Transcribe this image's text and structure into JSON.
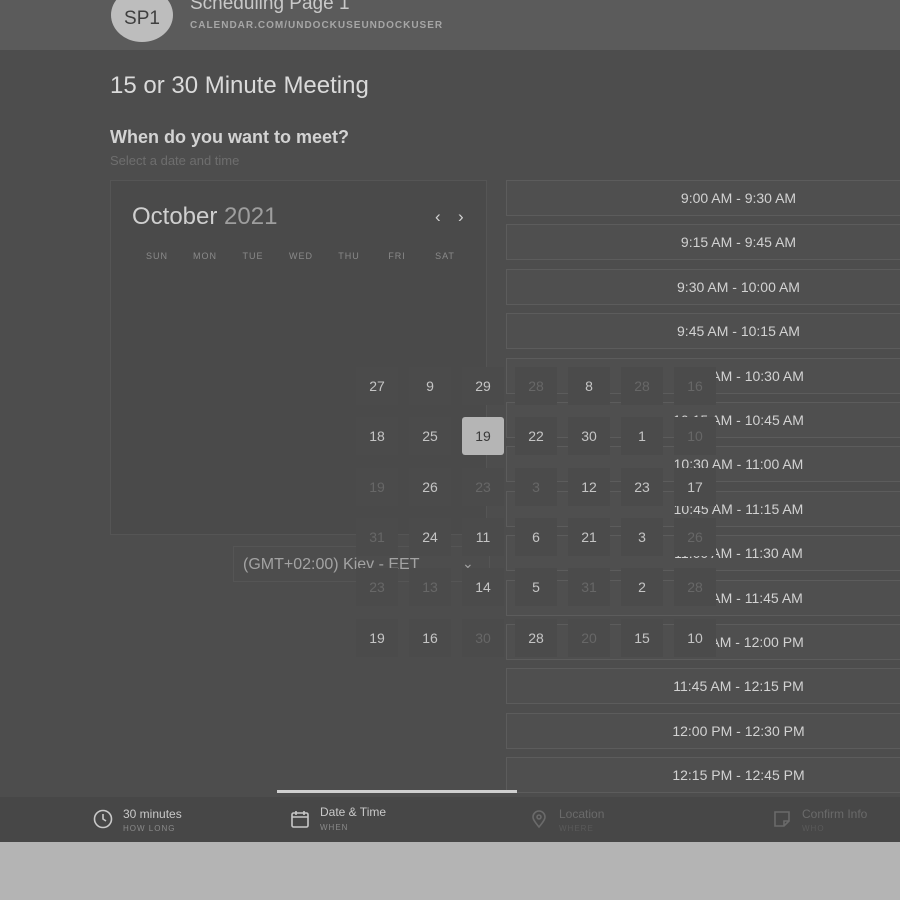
{
  "header": {
    "avatar_text": "SP1",
    "page_name": "Scheduling Page 1",
    "url": "CALENDAR.COM/UNDOCKUSEUNDOCKUSER"
  },
  "main": {
    "title": "15 or 30 Minute Meeting",
    "question": "When do you want to meet?",
    "subtitle": "Select a date and time"
  },
  "calendar": {
    "month": "October",
    "year": "2021",
    "prev_icon": "chevron-left-icon",
    "next_icon": "chevron-right-icon",
    "weekdays": [
      "SUN",
      "MON",
      "TUE",
      "WED",
      "THU",
      "FRI",
      "SAT"
    ],
    "selected_day": "19",
    "grid_rows": [
      [
        "27",
        "9",
        "29",
        "28",
        "8",
        "28",
        "16"
      ],
      [
        "18",
        "25",
        "19",
        "22",
        "30",
        "1",
        "10"
      ],
      [
        "19",
        "26",
        "23",
        "3",
        "12",
        "23",
        "17"
      ],
      [
        "31",
        "24",
        "11",
        "6",
        "21",
        "3",
        "26"
      ],
      [
        "23",
        "13",
        "14",
        "5",
        "31",
        "2",
        "28"
      ],
      [
        "19",
        "16",
        "30",
        "28",
        "20",
        "15",
        "10"
      ]
    ],
    "dimmed": [
      [
        false,
        false,
        false,
        true,
        false,
        true,
        true
      ],
      [
        false,
        false,
        false,
        false,
        false,
        false,
        true
      ],
      [
        true,
        false,
        true,
        true,
        false,
        false,
        false
      ],
      [
        true,
        false,
        false,
        false,
        false,
        false,
        true
      ],
      [
        true,
        true,
        false,
        false,
        true,
        false,
        true
      ],
      [
        false,
        false,
        true,
        false,
        true,
        false,
        false
      ]
    ]
  },
  "timezone": {
    "label": "(GMT+02:00) Kiev - EET",
    "icon": "chevron-down-icon"
  },
  "time_slots": [
    "9:00 AM - 9:30 AM",
    "9:15 AM - 9:45 AM",
    "9:30 AM - 10:00 AM",
    "9:45 AM - 10:15 AM",
    "10:00 AM - 10:30 AM",
    "10:15 AM - 10:45 AM",
    "10:30 AM - 11:00 AM",
    "10:45 AM - 11:15 AM",
    "11:00 AM - 11:30 AM",
    "11:15 AM - 11:45 AM",
    "11:30 AM - 12:00 PM",
    "11:45 AM - 12:15 PM",
    "12:00 PM - 12:30 PM",
    "12:15 PM - 12:45 PM"
  ],
  "footer": {
    "steps": [
      {
        "label": "30 minutes",
        "sub": "HOW LONG",
        "icon": "clock-icon",
        "active": true
      },
      {
        "label": "Date & Time",
        "sub": "WHEN",
        "icon": "calendar-icon",
        "active": true
      },
      {
        "label": "Location",
        "sub": "WHERE",
        "icon": "location-pin-icon",
        "active": false
      },
      {
        "label": "Confirm Info",
        "sub": "WHO",
        "icon": "note-icon",
        "active": false
      }
    ]
  }
}
